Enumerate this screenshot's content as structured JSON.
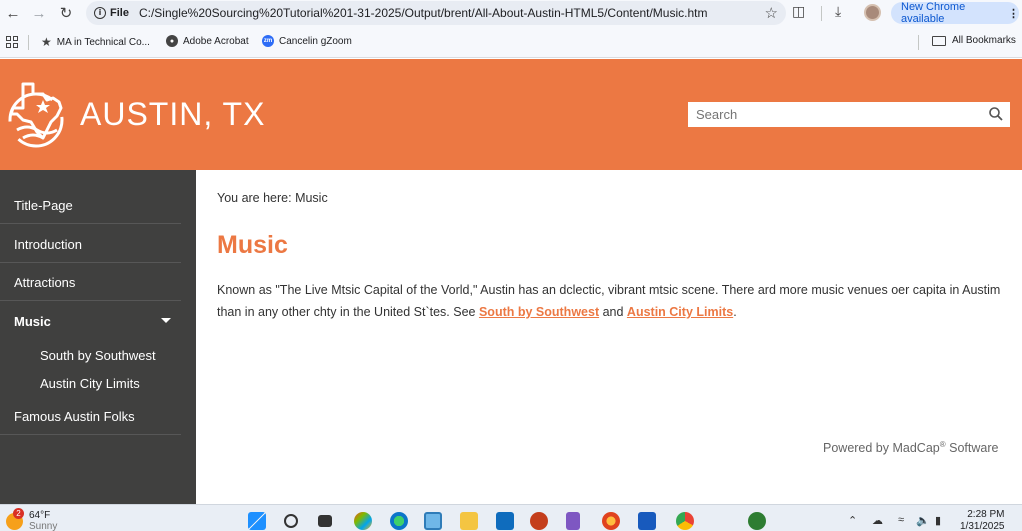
{
  "browser": {
    "file_label": "File",
    "url": "C:/Single%20Sourcing%20Tutorial%201-31-2025/Output/brent/All-About-Austin-HTML5/Content/Music.htm",
    "update_label": "New Chrome available"
  },
  "bookmarks": {
    "items": [
      {
        "label": "MA in Technical Co..."
      },
      {
        "label": "Adobe Acrobat"
      },
      {
        "label": "Cancelin gZoom"
      }
    ],
    "all_label": "All Bookmarks"
  },
  "header": {
    "site_title": "AUSTIN, TX",
    "search_placeholder": "Search"
  },
  "sidebar": {
    "items": [
      {
        "label": "Title-Page"
      },
      {
        "label": "Introduction"
      },
      {
        "label": "Attractions"
      },
      {
        "label": "Music"
      },
      {
        "label": "Famous Austin Folks"
      }
    ],
    "subitems": [
      {
        "label": "South by Southwest"
      },
      {
        "label": "Austin City Limits"
      }
    ]
  },
  "main": {
    "breadcrumb": "You are here: Music",
    "title": "Music",
    "paragraph_part1": "Known as \"The Live Mtsic Capital of the Vorld,\" Austin has an dclectic, vibrant mtsic scene. There ard more music venues oer capita in Austim than in any other chty in the United St`tes. See ",
    "link1": "South by Southwest",
    "paragraph_and": " and ",
    "link2": "Austin City Limits",
    "paragraph_end": ".",
    "powered_pre": "Powered by MadCap",
    "powered_sup": "®",
    "powered_post": " Software"
  },
  "taskbar": {
    "temperature": "64°F",
    "condition": "Sunny",
    "badge_count": "2",
    "time": "2:28 PM",
    "date": "1/31/2025"
  },
  "colors": {
    "brand_orange": "#ec7843",
    "sidebar_bg": "#40403f"
  }
}
